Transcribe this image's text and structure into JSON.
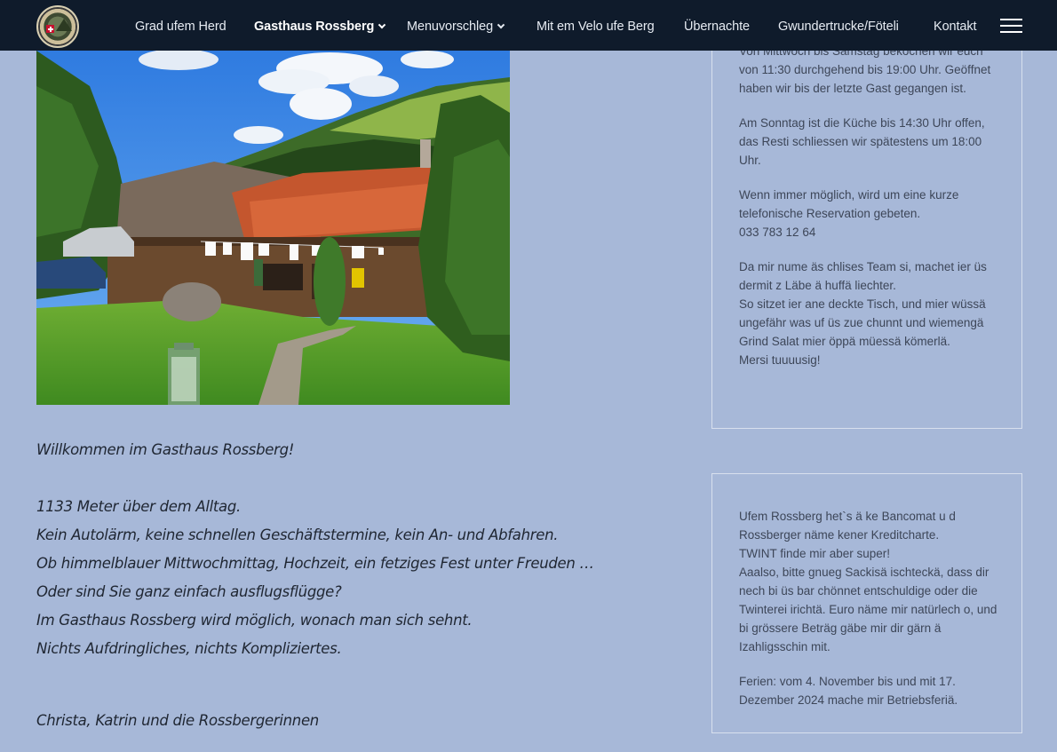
{
  "nav": {
    "logo_alt": "Gasthaus Rossberg logo",
    "items": [
      {
        "label": "Grad ufem Herd",
        "dropdown": false
      },
      {
        "label": "Gasthaus Rossberg",
        "dropdown": true,
        "active": true
      },
      {
        "label": "Menuvorschleg",
        "dropdown": true
      },
      {
        "label": "Mit em Velo ufe Berg",
        "dropdown": false
      },
      {
        "label": "Übernachte",
        "dropdown": false
      },
      {
        "label": "Gwundertrucke/Föteli",
        "dropdown": false
      },
      {
        "label": "Kontakt",
        "dropdown": false
      }
    ],
    "menu_icon": "hamburger-icon"
  },
  "photo": {
    "alt": "Gasthaus Rossberg farmhouse with laundry line and lantern"
  },
  "welcome": {
    "heading": "Willkommen im Gasthaus Rossberg!",
    "lines": [
      "1133 Meter über dem Alltag.",
      "Kein Autolärm, keine schnellen Geschäftstermine, kein An- und Abfahren.",
      "Ob himmelblauer Mittwochmittag, Hochzeit, ein fetziges Fest unter Freuden …",
      "Oder sind Sie ganz einfach ausflugsflügge?",
      "Im Gasthaus Rossberg wird möglich, wonach man sich sehnt.",
      "Nichts Aufdringliches, nichts Kompliziertes."
    ],
    "signature": "Christa, Katrin und die Rossbergerinnen"
  },
  "box1": {
    "paragraphs": [
      [
        "Von Mittwoch bis Samstag bekochen wir euch von 11:30 durchgehend bis 19:00 Uhr. Geöffnet haben wir bis der letzte Gast gegangen ist."
      ],
      [
        "Am Sonntag ist die Küche bis 14:30 Uhr offen, das Resti schliessen wir spätestens um 18:00 Uhr."
      ],
      [
        "Wenn immer möglich, wird um eine kurze telefonische Reservation gebeten.",
        "033 783 12 64"
      ],
      [
        "Da mir nume äs chlises Team si, machet ier üs dermit z Läbe ä huffä liechter.",
        "So sitzet ier ane deckte Tisch, und mier wüssä ungefähr was uf üs zue chunnt und wiemengä Grind Salat mier öppä müessä kömerlä.",
        "Mersi tuuuusig!"
      ]
    ]
  },
  "box2": {
    "paragraphs": [
      [
        "Ufem Rossberg het`s ä ke Bancomat u d Rossberger näme kener Kreditcharte.",
        "TWINT finde mir aber super!",
        "Aaalso, bitte gnueg Sackisä ischteckä, dass dir nech bi üs bar chönnet entschuldige oder die Twinterei irichtä. Euro näme mir natürlech o, und bi grössere Beträg gäbe mir dir gärn ä Izahligsschin mit."
      ],
      [
        "Ferien: vom 4. November bis und mit 17. Dezember 2024 mache mir Betriebsferiä."
      ]
    ]
  }
}
